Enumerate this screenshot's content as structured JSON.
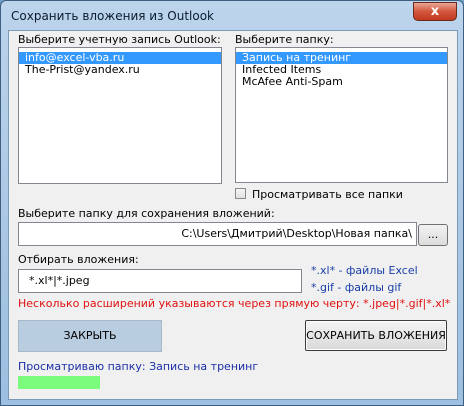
{
  "window": {
    "title": "Сохранить вложения из Outlook",
    "close_glyph": "x"
  },
  "accounts": {
    "label": "Выберите учетную запись Outlook:",
    "items": [
      "info@excel-vba.ru",
      "The-Prist@yandex.ru"
    ],
    "selected": 0
  },
  "folders": {
    "label": "Выберите папку:",
    "items": [
      "Запись на тренинг",
      "Infected Items",
      "McAfee Anti-Spam"
    ],
    "selected": 0
  },
  "browse_all": {
    "label": "Просматривать все папки",
    "checked": false
  },
  "save_folder": {
    "label": "Выберите папку для сохранения вложений:",
    "value": "C:\\Users\\Дмитрий\\Desktop\\Новая папка\\",
    "browse_label": "..."
  },
  "filter": {
    "label": "Отбирать вложения:",
    "value": "*.xl*|*.jpeg",
    "hint1_code": "*.xl*",
    "hint1_text": " - файлы Excel",
    "hint2_code": "*.gif",
    "hint2_text": " - файлы gif",
    "note_text": "Несколько расширений указываются через прямую черту: ",
    "note_example": "*.jpeg|*.gif|*.xl*"
  },
  "buttons": {
    "close_label": "ЗАКРЫТЬ",
    "save_label": "СОХРАНИТЬ ВЛОЖЕНИЯ"
  },
  "status": {
    "text": "Просматриваю папку: Запись на тренинг"
  },
  "colors": {
    "selection": "#3399ff",
    "hint": "#1a3ea8",
    "warning": "#e01010",
    "progress": "#7cfc7c"
  }
}
